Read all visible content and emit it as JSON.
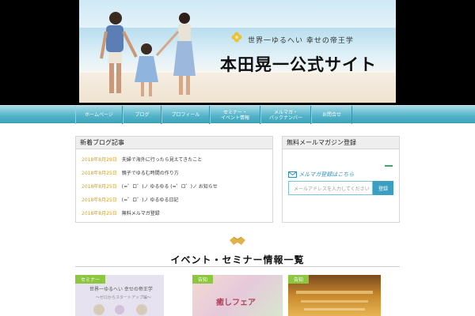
{
  "header": {
    "tagline": "世界一ゆるへい 幸せの帝王学",
    "site_title": "本田晃一公式サイト"
  },
  "nav": {
    "items": [
      {
        "label": "ホームページ"
      },
      {
        "label": "ブログ"
      },
      {
        "label": "プロフィール"
      },
      {
        "label": "セミナー・\nイベント情報"
      },
      {
        "label": "メルマガ・\nバックナンバー"
      },
      {
        "label": "お問合せ"
      }
    ]
  },
  "news": {
    "title": "新着ブログ記事",
    "items": [
      {
        "date": "2018年8月29日",
        "text": "夫婦で海外に行ったら見えてきたこと"
      },
      {
        "date": "2018年8月25日",
        "text": "親子でゆるむ時間の作り方"
      },
      {
        "date": "2018年8月25日",
        "text": "(=゜ロ゜)ノ ゆるゆる (=゜ロ゜)ノ お知らせ"
      },
      {
        "date": "2018年8月25日",
        "text": "(=゜ロ゜)ノ ゆるゆる日記"
      },
      {
        "date": "2018年8月25日",
        "text": "無料メルマガ登録"
      }
    ]
  },
  "mailmag": {
    "title": "無料メールマガジン登録",
    "signup_label": "メルマガ登録はこちら",
    "email_placeholder": "メールアドレスを入力してください",
    "submit_label": "登録"
  },
  "info_section": {
    "title": "イベント・セミナー情報一覧"
  },
  "cards": [
    {
      "badge": "セミナー",
      "overlay": "世界一ゆるへい 幸せの帝王学",
      "subline": "〜ゼロからスタートアップ編〜"
    },
    {
      "badge": "告知",
      "overlay": "癒しフェア"
    },
    {
      "badge": "告知"
    }
  ],
  "colors": {
    "nav_top": "#a8dbe6",
    "nav_bottom": "#3aa0b8",
    "date_accent": "#d9a21b",
    "badge_green": "#8dc63f",
    "mail_blue": "#3a9fc1"
  }
}
